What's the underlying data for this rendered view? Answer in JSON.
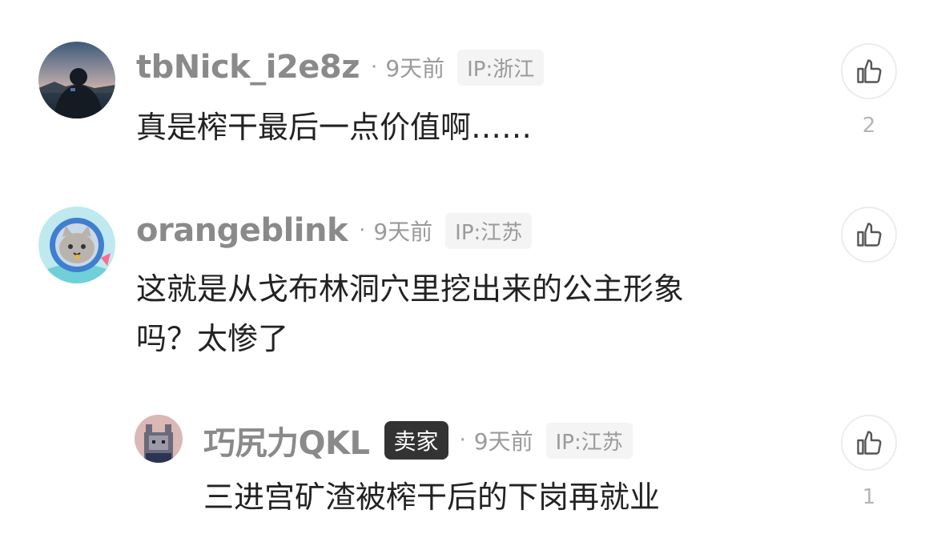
{
  "comments": [
    {
      "username": "tbNick_i2e8z",
      "separator": "·",
      "time": "9天前",
      "ip": "IP:浙江",
      "text": "真是榨干最后一点价值啊……",
      "likes": "2",
      "avatar_icon": "night-lake-avatar-icon"
    },
    {
      "username": "orangeblink",
      "separator": "·",
      "time": "9天前",
      "ip": "IP:江苏",
      "text_line1": "这就是从戈布林洞穴里挖出来的公主形象",
      "text_line2": "吗？太惨了",
      "likes": "",
      "avatar_icon": "astronaut-cat-avatar-icon"
    }
  ],
  "reply": {
    "username": "巧尻力QKL",
    "badge": "卖家",
    "separator": "·",
    "time": "9天前",
    "ip": "IP:江苏",
    "text": "三进宫矿渣被榨干后的下岗再就业",
    "likes": "1",
    "avatar_icon": "pixel-cat-avatar-icon"
  },
  "icons": {
    "like": "thumbs-up-icon"
  },
  "colors": {
    "username": "#8a8a8a",
    "text": "#222222",
    "badge_bg": "#333333",
    "ip_bg": "#f4f4f4"
  }
}
